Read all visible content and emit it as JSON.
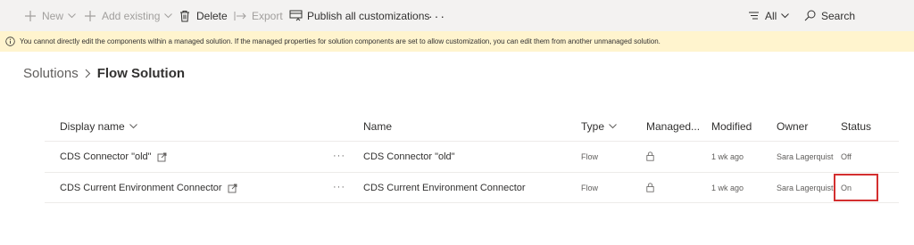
{
  "toolbar": {
    "new_label": "New",
    "add_existing_label": "Add existing",
    "delete_label": "Delete",
    "export_label": "Export",
    "publish_label": "Publish all customizations",
    "more_label": "···",
    "filter_label": "All",
    "search_label": "Search"
  },
  "banner": {
    "message": "You cannot directly edit the components within a managed solution. If the managed properties for solution components are set to allow customization, you can edit them from another unmanaged solution."
  },
  "breadcrumb": {
    "root": "Solutions",
    "current": "Flow Solution"
  },
  "grid": {
    "columns": {
      "display_name": "Display name",
      "name": "Name",
      "type": "Type",
      "managed": "Managed...",
      "modified": "Modified",
      "owner": "Owner",
      "status": "Status"
    },
    "rows": [
      {
        "display_name": "CDS Connector \"old\"",
        "more": "···",
        "name": "CDS Connector \"old\"",
        "type": "Flow",
        "modified": "1 wk ago",
        "owner": "Sara Lagerquist",
        "status": "Off"
      },
      {
        "display_name": "CDS Current Environment Connector",
        "more": "···",
        "name": "CDS Current Environment Connector",
        "type": "Flow",
        "modified": "1 wk ago",
        "owner": "Sara Lagerquist",
        "status": "On"
      }
    ]
  },
  "colors": {
    "toolbar_bg": "#f3f2f1",
    "banner_bg": "#fff4ce",
    "highlight_border": "#d32f2f",
    "disabled_text": "#a19f9d"
  },
  "icons": {
    "new": "plus-icon",
    "add_existing": "plus-icon",
    "delete": "trash-icon",
    "export": "export-arrow-icon",
    "publish": "publish-icon",
    "filter": "filter-lines-icon",
    "search": "search-icon",
    "info": "info-icon",
    "external_link": "external-link-icon",
    "managed": "lock-icon"
  }
}
